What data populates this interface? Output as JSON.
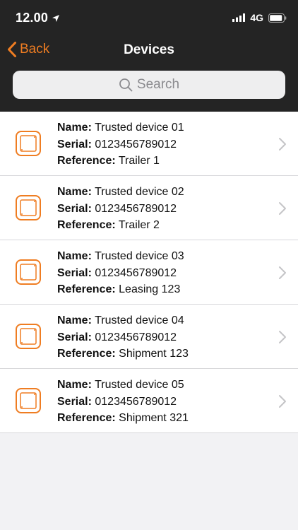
{
  "status_bar": {
    "time": "12.00",
    "network": "4G"
  },
  "nav": {
    "back_label": "Back",
    "title": "Devices"
  },
  "search": {
    "placeholder": "Search"
  },
  "labels": {
    "name": "Name:",
    "serial": "Serial:",
    "reference": "Reference:"
  },
  "devices": [
    {
      "name": "Trusted device 01",
      "serial": "0123456789012",
      "reference": "Trailer 1"
    },
    {
      "name": "Trusted device 02",
      "serial": "0123456789012",
      "reference": "Trailer 2"
    },
    {
      "name": "Trusted device 03",
      "serial": "0123456789012",
      "reference": "Leasing 123"
    },
    {
      "name": "Trusted device 04",
      "serial": "0123456789012",
      "reference": "Shipment 123"
    },
    {
      "name": "Trusted device 05",
      "serial": "0123456789012",
      "reference": "Shipment 321"
    }
  ],
  "colors": {
    "accent": "#ef7d22",
    "header_bg": "#242424"
  }
}
